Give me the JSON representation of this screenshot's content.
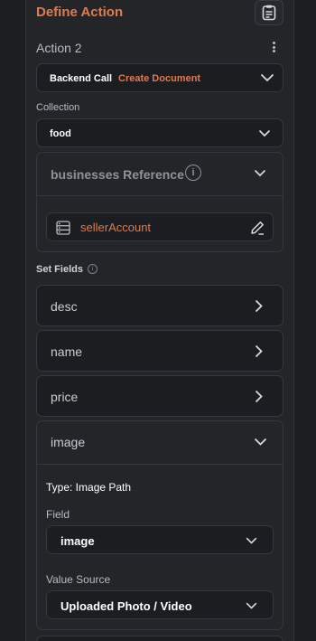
{
  "header": {
    "title": "Define Action",
    "doc_icon": "document-list-icon"
  },
  "action": {
    "label": "Action 2",
    "menu_icon": "kebab-menu-icon"
  },
  "backend_call": {
    "type": "Backend Call",
    "operation": "Create Document"
  },
  "collection": {
    "label": "Collection",
    "value": "food"
  },
  "reference": {
    "title": "businesses Reference",
    "info_icon": "info-icon",
    "field_value": "sellerAccount",
    "field_icon": "database-icon",
    "edit_icon": "pencil-icon"
  },
  "set_fields": {
    "label": "Set Fields",
    "fields": [
      {
        "name": "desc"
      },
      {
        "name": "name"
      },
      {
        "name": "price"
      }
    ],
    "image": {
      "name": "image",
      "type_text": "Type: Image Path",
      "field_label": "Field",
      "field_value": "image",
      "value_source_label": "Value Source",
      "value_source_value": "Uploaded Photo / Video"
    }
  },
  "colors": {
    "accent": "#e07a4f",
    "panel": "#232529",
    "input_bg": "#1b1d20",
    "border": "#35383e"
  }
}
